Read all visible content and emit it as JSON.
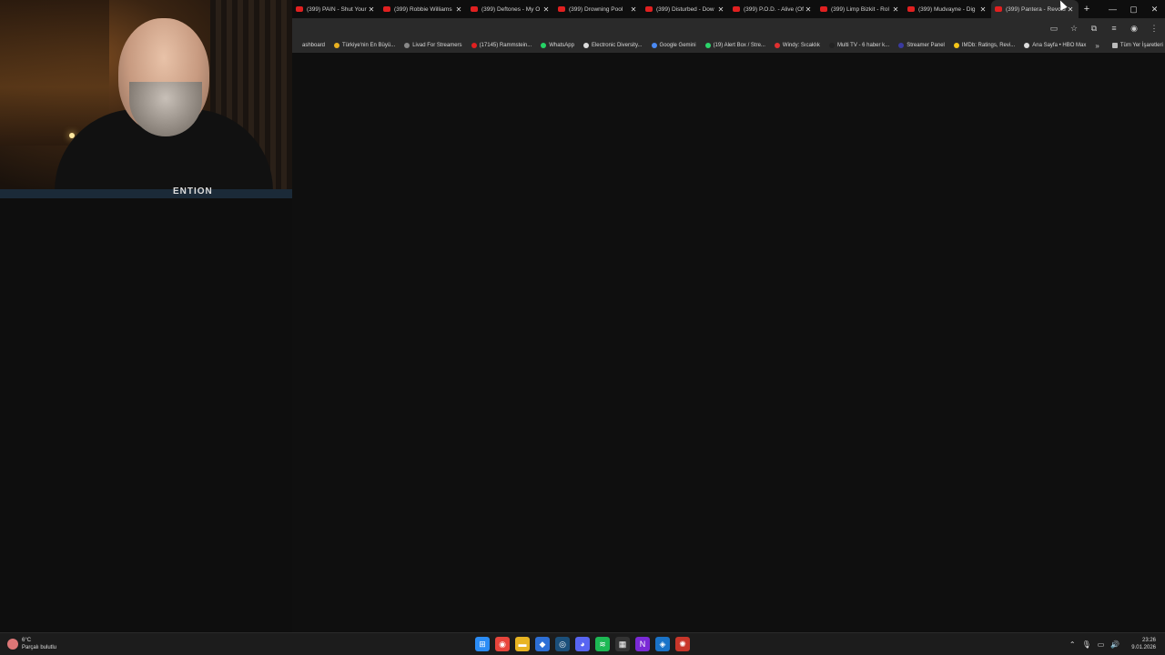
{
  "webcam": {
    "shirt_text": "ENTION"
  },
  "tabs": [
    {
      "title": "(399) PAIN - Shut Your",
      "active": false
    },
    {
      "title": "(399) Robbie Williams",
      "active": false
    },
    {
      "title": "(399) Deftones - My O",
      "active": false
    },
    {
      "title": "(399) Drowning Pool",
      "active": false
    },
    {
      "title": "(399) Disturbed - Dow",
      "active": false
    },
    {
      "title": "(399) P.O.D. - Alive (Of",
      "active": false
    },
    {
      "title": "(399) Limp Bizkit - Rol",
      "active": false
    },
    {
      "title": "(399) Mudvayne - Dig",
      "active": false
    },
    {
      "title": "(399) Pantera - Revolu",
      "active": true
    }
  ],
  "tab_close_glyph": "✕",
  "new_tab_glyph": "+",
  "window_controls": {
    "minimize": "—",
    "maximize": "▢",
    "close": "✕"
  },
  "toolbar_icons": [
    "cast-icon",
    "star-icon",
    "extensions-icon",
    "media-icon",
    "profile-icon",
    "menu-icon"
  ],
  "toolbar_glyphs": {
    "cast": "▭",
    "star": "☆",
    "extensions": "⧉",
    "media": "≡",
    "profile": "◉",
    "menu": "⋮"
  },
  "bookmarks": [
    {
      "label": "ashboard",
      "color": "#2a2a2a"
    },
    {
      "label": "Türkiye'nin En Büyü...",
      "color": "#e8b020"
    },
    {
      "label": "Livad For Streamers",
      "color": "#888888"
    },
    {
      "label": "(17145) Rammstein...",
      "color": "#e02020"
    },
    {
      "label": "WhatsApp",
      "color": "#25d366"
    },
    {
      "label": "Electronic Diversity...",
      "color": "#dddddd"
    },
    {
      "label": "Google Gemini",
      "color": "#4a8af4"
    },
    {
      "label": "(19) Alert Box / Stre...",
      "color": "#2bd46a"
    },
    {
      "label": "Windy: Sıcaklık",
      "color": "#e03030"
    },
    {
      "label": "Multi TV - 6 haber k...",
      "color": "#222222"
    },
    {
      "label": "Streamer Panel",
      "color": "#3a3aa0"
    },
    {
      "label": "IMDb: Ratings, Revi...",
      "color": "#f5c518"
    },
    {
      "label": "Ana Sayfa • HBO Max",
      "color": "#dddddd"
    }
  ],
  "bookmarks_more": "»",
  "all_bookmarks": "Tüm Yer İşaretleri",
  "weather": {
    "temp": "6°C",
    "desc": "Parçalı bulutlu"
  },
  "taskbar_apps": [
    {
      "name": "windows-start-icon",
      "color": "#2b8cf5",
      "glyph": "⊞"
    },
    {
      "name": "chrome-icon",
      "color": "#e8453c",
      "glyph": "◉"
    },
    {
      "name": "file-explorer-icon",
      "color": "#e8b422",
      "glyph": "▬"
    },
    {
      "name": "app-blue-icon",
      "color": "#2d6fd6",
      "glyph": "◆"
    },
    {
      "name": "steam-icon",
      "color": "#1b4f7a",
      "glyph": "◎"
    },
    {
      "name": "discord-icon",
      "color": "#5865f2",
      "glyph": "◕"
    },
    {
      "name": "spotify-icon",
      "color": "#1db954",
      "glyph": "≋"
    },
    {
      "name": "calculator-icon",
      "color": "#333333",
      "glyph": "▦"
    },
    {
      "name": "next-app-icon",
      "color": "#7a2ad6",
      "glyph": "N"
    },
    {
      "name": "app-cyan-icon",
      "color": "#1a73c8",
      "glyph": "◈"
    },
    {
      "name": "app-red-icon",
      "color": "#c8362a",
      "glyph": "✺"
    }
  ],
  "tray_glyphs": [
    "⌃",
    "🎙",
    "▭",
    "🔊"
  ],
  "clock": {
    "time": "23:26",
    "date": "9.01.2026"
  }
}
